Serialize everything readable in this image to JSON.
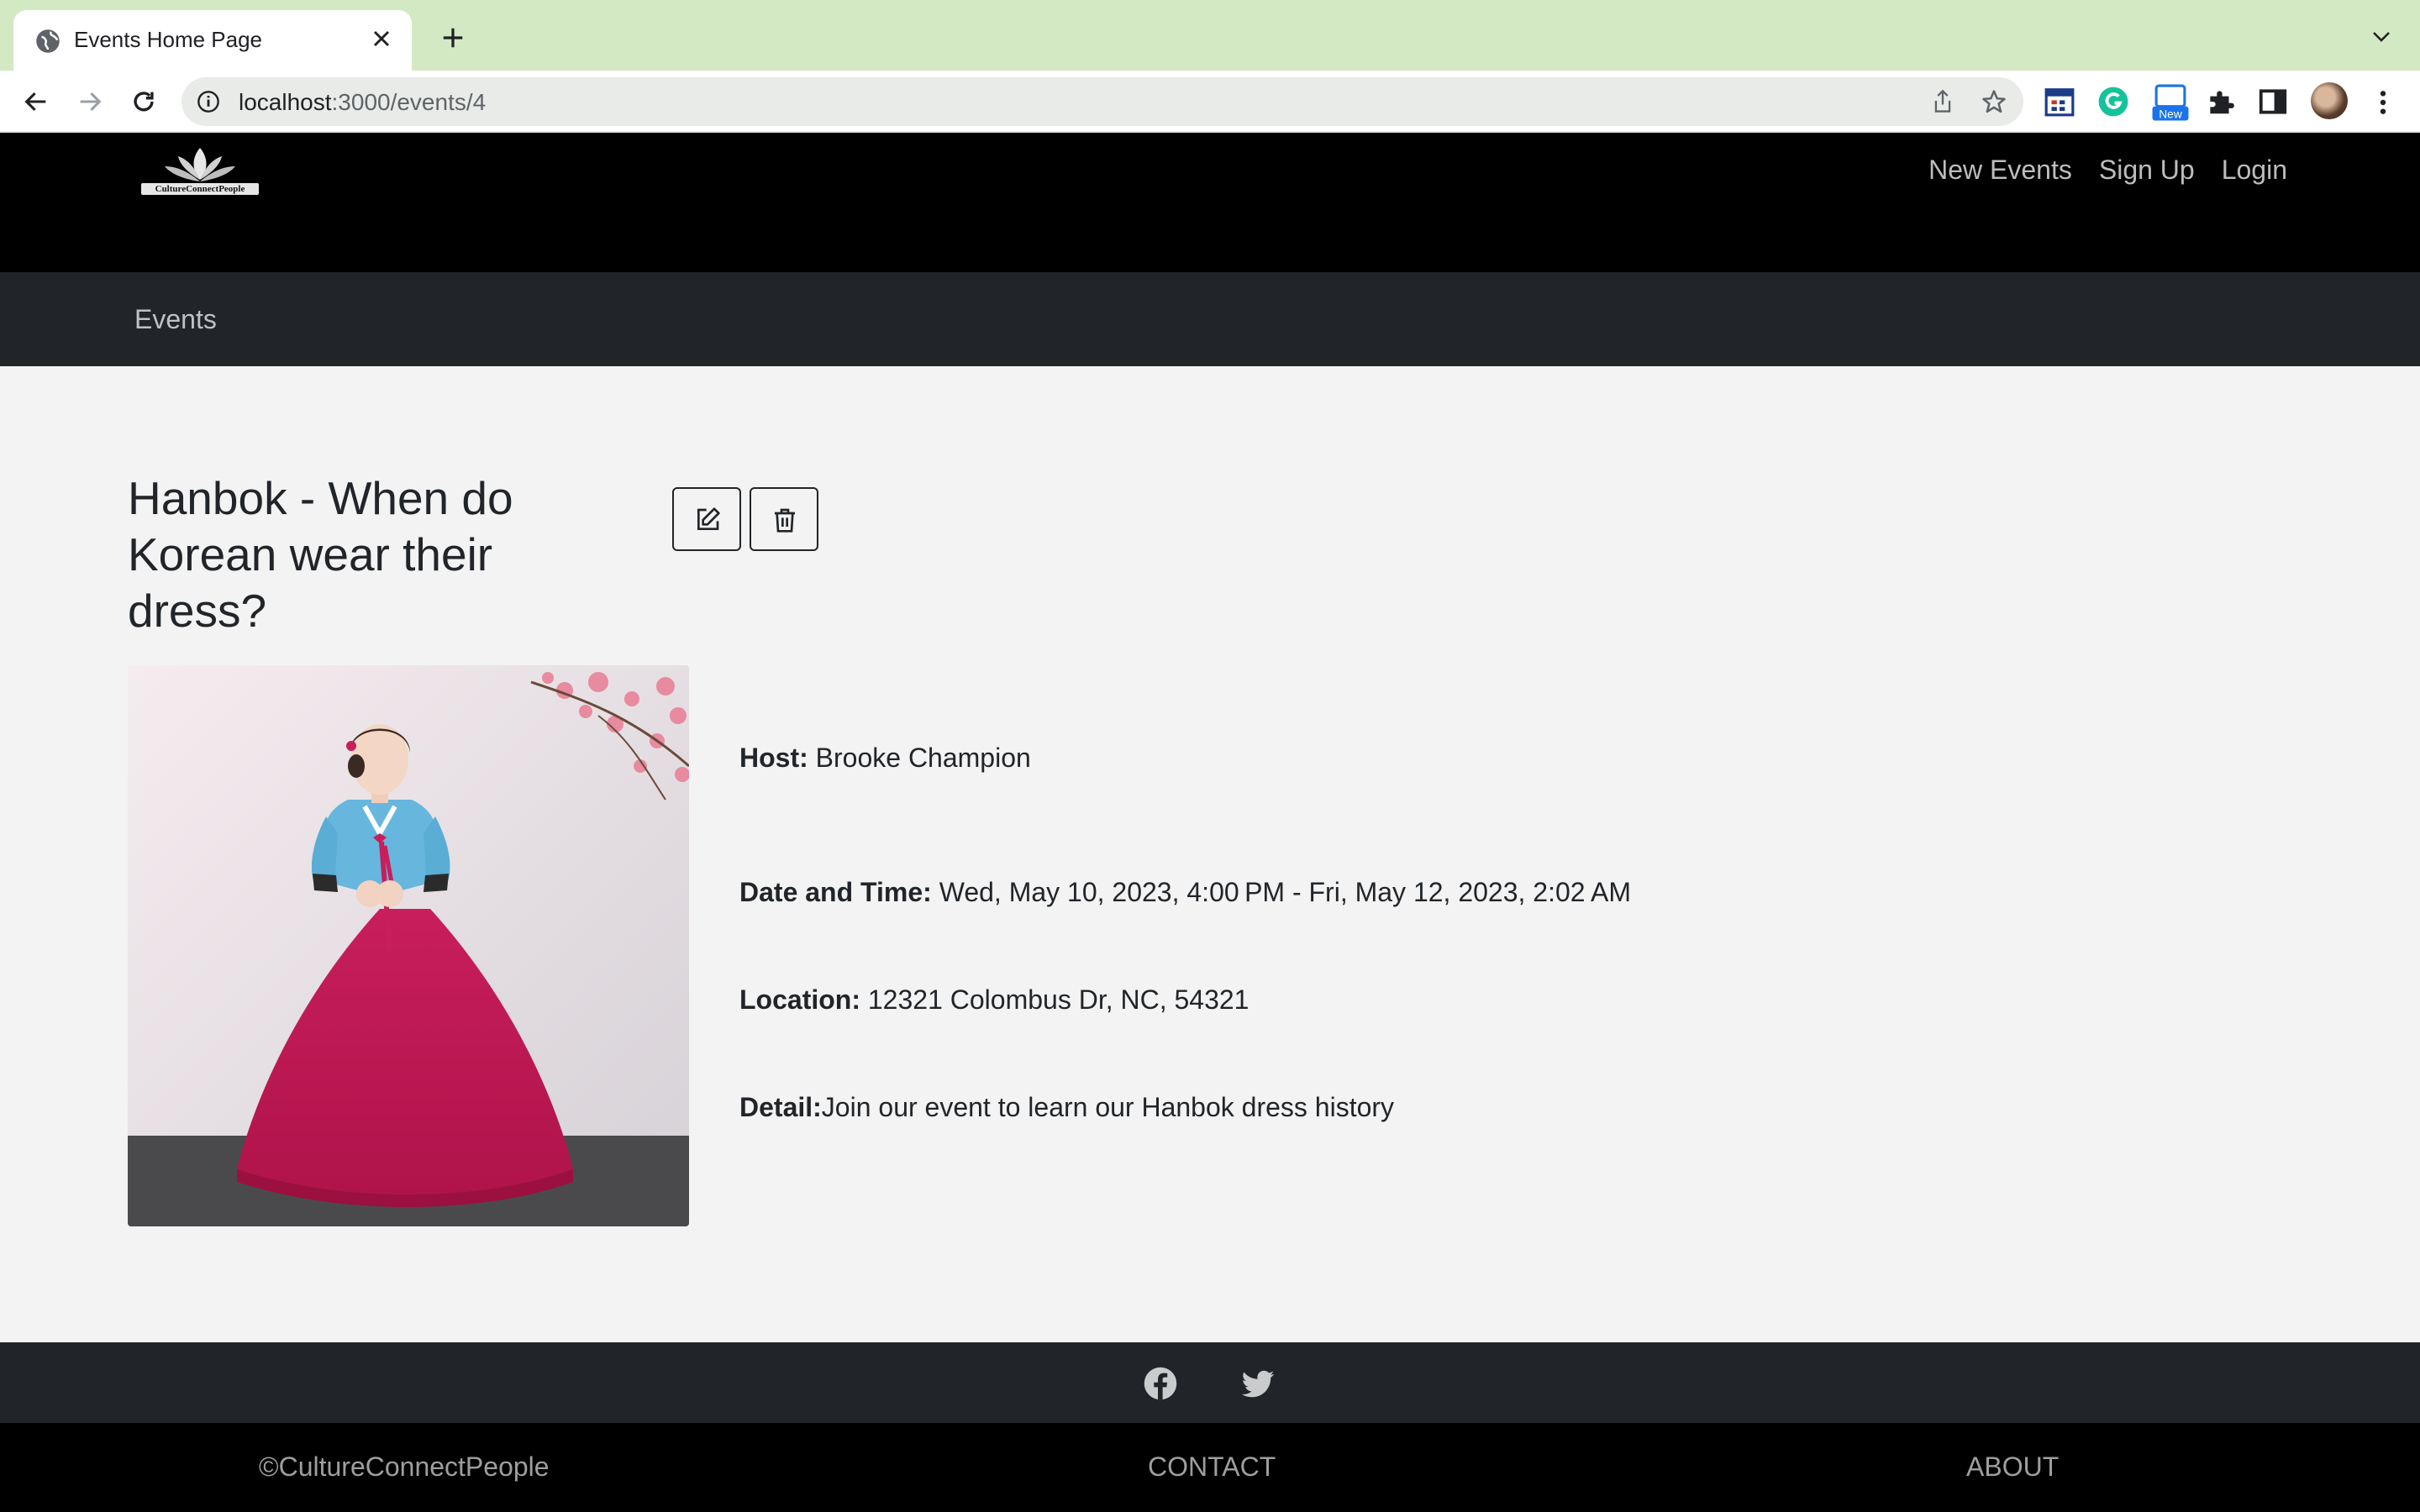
{
  "browser": {
    "tab_title": "Events Home Page",
    "url_host": "localhost",
    "url_path": ":3000/events/4",
    "extension_badge": "New"
  },
  "site": {
    "logo_text": "CultureConnectPeople",
    "nav_links": [
      "New Events",
      "Sign Up",
      "Login"
    ],
    "subnav_link": "Events"
  },
  "event": {
    "title": "Hanbok - When do Korean wear their dress?",
    "host_label": "Host:",
    "host_value": " Brooke Champion",
    "datetime_label": "Date and Time:",
    "datetime_value": " Wed, May 10, 2023, 4:00 PM - Fri, May 12, 2023, 2:02 AM",
    "location_label": "Location:",
    "location_value": " 12321 Colombus Dr, NC, 54321",
    "detail_label": "Detail:",
    "detail_value": "Join our event to learn our Hanbok dress history"
  },
  "footer": {
    "copyright": "©CultureConnectPeople",
    "contact": "CONTACT",
    "about": "ABOUT",
    "social_icons": [
      "facebook-icon",
      "twitter-icon"
    ]
  },
  "colors": {
    "browser_frame": "#d3e9c4",
    "navbar": "#000000",
    "subnav": "#212529",
    "page_bg": "#f3f3f3"
  }
}
